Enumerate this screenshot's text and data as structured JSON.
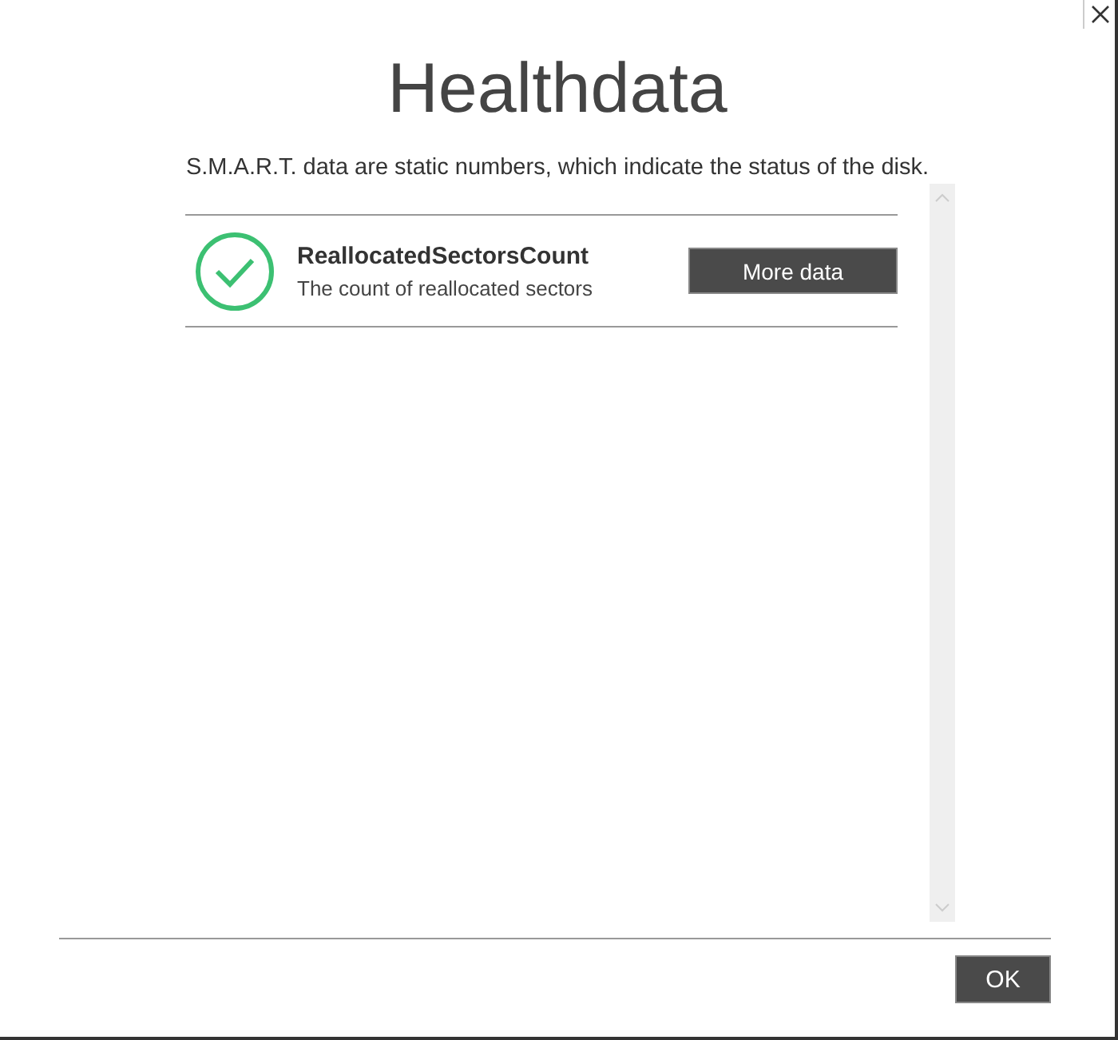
{
  "title": "Healthdata",
  "subtitle": "S.M.A.R.T. data are static numbers, which indicate the status of the disk.",
  "attributes": [
    {
      "name": "ReallocatedSectorsCount",
      "description": "The count of reallocated sectors",
      "kind": "ok",
      "button": "More data"
    }
  ],
  "buttons": [
    "OK"
  ]
}
